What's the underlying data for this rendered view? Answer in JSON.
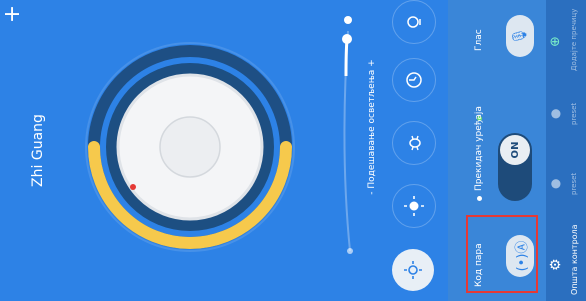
{
  "app": {
    "title": "Zhi Guang"
  },
  "header": {
    "add_icon": "plus-icon"
  },
  "dial": {
    "brightness_level": 0.72
  },
  "slider": {
    "label": "- Подешавање осветљења +",
    "value": 0.92
  },
  "modes": [
    {
      "icon": "light-bulb-icon",
      "active": false
    },
    {
      "icon": "moon-clock-icon",
      "active": false
    },
    {
      "icon": "bug-icon",
      "active": false
    },
    {
      "icon": "sun-icon",
      "active": false
    },
    {
      "icon": "sun-outline-icon",
      "active": true
    }
  ],
  "controls": {
    "voice_label": "Глас",
    "voice_icon": "microphone-icon",
    "switch_label": "Прекидач уређаја",
    "switch_state": "ON",
    "pair_label": "Код пара",
    "pair_icon": "signal-tower-icon"
  },
  "strip": {
    "items": [
      {
        "label": "Додајте пречицу",
        "icon": "plus-circle-icon"
      },
      {
        "label": "preset",
        "icon": "drop-icon"
      },
      {
        "label": "preset",
        "icon": "drop-icon"
      },
      {
        "label": "Општа контрола",
        "icon": "gear-icon"
      }
    ]
  },
  "colors": {
    "background": "#2d82e6",
    "arc": "#f6c94c",
    "highlight": "#e53935"
  }
}
